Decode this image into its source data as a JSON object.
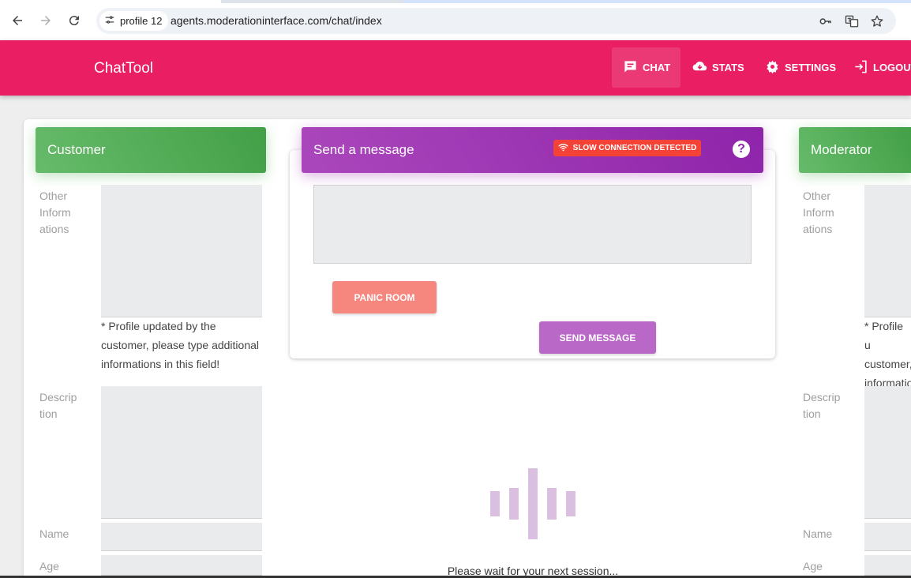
{
  "browser": {
    "profile_label": "profile 12",
    "url": "agents.moderationinterface.com/chat/index"
  },
  "app": {
    "brand": "ChatTool",
    "nav": {
      "chat": "CHAT",
      "stats": "STATS",
      "settings": "SETTINGS",
      "logout": "LOGOUT"
    }
  },
  "customer": {
    "title": "Customer",
    "other_info_label": "Other Inform ations",
    "note": "* Profile updated by the customer, please type additional informations in this field!",
    "description_label": "Descrip tion",
    "name_label": "Name",
    "age_label": "Age"
  },
  "message": {
    "title": "Send a message",
    "slow_connection": "SLOW CONNECTION DETECTED",
    "help": "?",
    "panic_button": "PANIC ROOM",
    "send_button": "SEND MESSAGE",
    "wait_text": "Please wait for your next session..."
  },
  "moderator": {
    "title": "Moderator",
    "other_info_label": "Other Inform ations",
    "note": "* Profile u customer, informatio",
    "description_label": "Descrip tion",
    "name_label": "Name",
    "age_label": "Age"
  },
  "colors": {
    "appbar": "#e91e63",
    "customer_header": "#4caf50",
    "message_header": "#9c27b0",
    "slow_badge": "#f44336",
    "panic": "#f6877f",
    "send": "#ba68c8"
  }
}
